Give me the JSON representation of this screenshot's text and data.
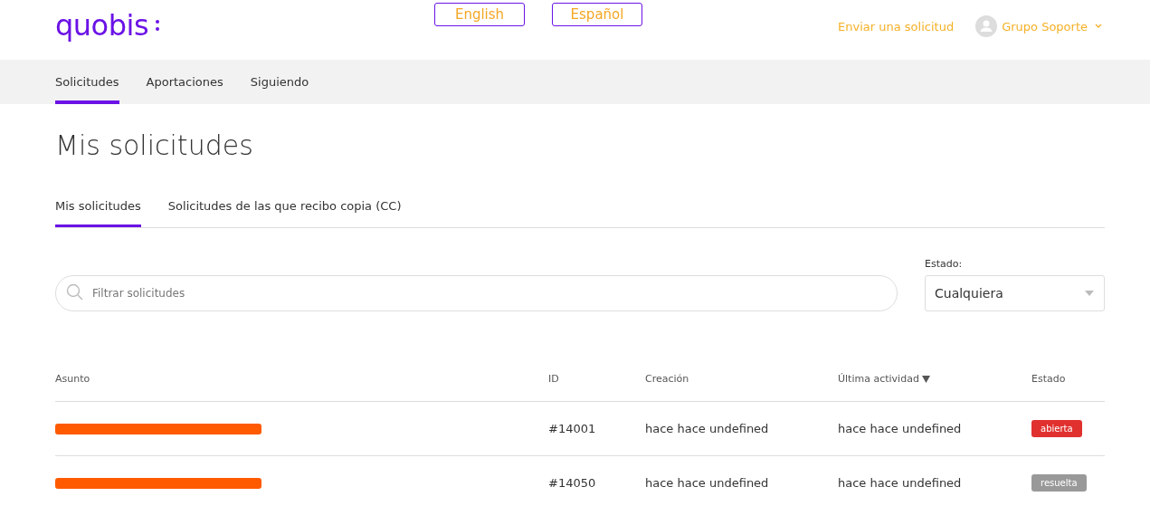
{
  "header": {
    "logo": "quobis",
    "languages": [
      {
        "label": "English"
      },
      {
        "label": "Español"
      }
    ],
    "submit_link": "Enviar una solicitud",
    "user": "Grupo Soporte"
  },
  "nav": [
    {
      "label": "Solicitudes",
      "selected": true
    },
    {
      "label": "Aportaciones",
      "selected": false
    },
    {
      "label": "Siguiendo",
      "selected": false
    }
  ],
  "title": "Mis solicitudes",
  "subtabs": [
    {
      "label": "Mis solicitudes",
      "selected": true
    },
    {
      "label": "Solicitudes de las que recibo copia (CC)",
      "selected": false
    }
  ],
  "search": {
    "placeholder": "Filtrar solicitudes"
  },
  "status_filter": {
    "label": "Estado:",
    "value": "Cualquiera"
  },
  "table": {
    "columns": [
      {
        "label": "Asunto",
        "sorted": false
      },
      {
        "label": "ID",
        "sorted": false
      },
      {
        "label": "Creación",
        "sorted": false
      },
      {
        "label": "Última actividad",
        "sorted": true
      },
      {
        "label": "Estado",
        "sorted": false
      }
    ],
    "rows": [
      {
        "id": "#14001",
        "created": "hace hace undefined",
        "last_activity": "hace hace undefined",
        "status": "abierta",
        "color": "#e0312f"
      },
      {
        "id": "#14050",
        "created": "hace hace undefined",
        "last_activity": "hace hace undefined",
        "status": "resuelta",
        "color": "#999999"
      }
    ]
  }
}
